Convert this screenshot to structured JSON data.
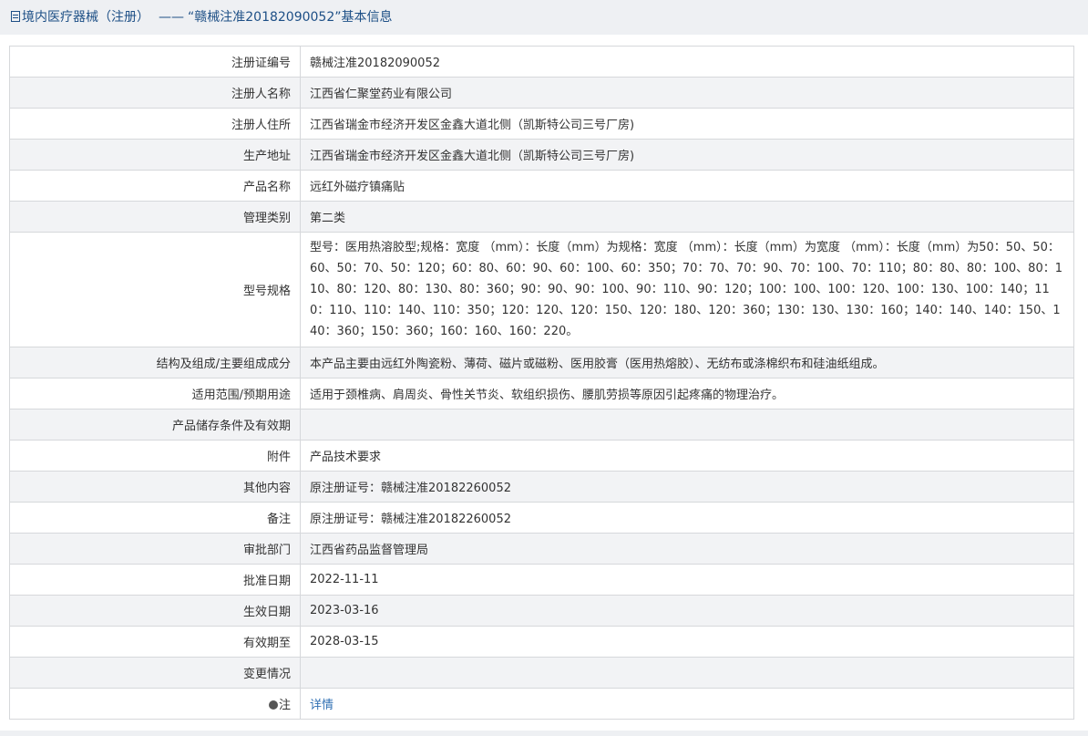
{
  "header": {
    "category": "境内医疗器械（注册）",
    "separator": "——",
    "title": "“赣械注准20182090052”基本信息"
  },
  "rows": [
    {
      "label": "注册证编号",
      "value": "赣械注准20182090052"
    },
    {
      "label": "注册人名称",
      "value": "江西省仁聚堂药业有限公司"
    },
    {
      "label": "注册人住所",
      "value": "江西省瑞金市经济开发区金鑫大道北侧（凯斯特公司三号厂房)"
    },
    {
      "label": "生产地址",
      "value": "江西省瑞金市经济开发区金鑫大道北侧（凯斯特公司三号厂房)"
    },
    {
      "label": "产品名称",
      "value": "远红外磁疗镇痛贴"
    },
    {
      "label": "管理类别",
      "value": "第二类"
    },
    {
      "label": "型号规格",
      "value": "型号：医用热溶胶型;规格：宽度 （mm）：长度（mm）为规格：宽度 （mm）：长度（mm）为宽度 （mm）：长度（mm）为50：50、50：60、50：70、50：120；60：80、60：90、60：100、60：350；70：70、70：90、70：100、70：110；80：80、80：100、80：110、80：120、80：130、80：360；90：90、90：100、90：110、90：120；100：100、100：120、100：130、100：140；110：110、110：140、110：350；120：120、120：150、120：180、120：360；130：130、130：160；140：140、140：150、140：360；150：360；160：160、160：220。"
    },
    {
      "label": "结构及组成/主要组成成分",
      "value": "本产品主要由远红外陶瓷粉、薄荷、磁片或磁粉、医用胶膏（医用热熔胶）、无纺布或涤棉织布和硅油纸组成。"
    },
    {
      "label": "适用范围/预期用途",
      "value": "适用于颈椎病、肩周炎、骨性关节炎、软组织损伤、腰肌劳损等原因引起疼痛的物理治疗。"
    },
    {
      "label": "产品储存条件及有效期",
      "value": ""
    },
    {
      "label": "附件",
      "value": "产品技术要求"
    },
    {
      "label": "其他内容",
      "value": "原注册证号：赣械注准20182260052"
    },
    {
      "label": "备注",
      "value": "原注册证号：赣械注准20182260052"
    },
    {
      "label": "审批部门",
      "value": "江西省药品监督管理局"
    },
    {
      "label": "批准日期",
      "value": "2022-11-11"
    },
    {
      "label": "生效日期",
      "value": "2023-03-16"
    },
    {
      "label": "有效期至",
      "value": "2028-03-15"
    },
    {
      "label": "变更情况",
      "value": ""
    }
  ],
  "note": {
    "label": "注",
    "link_text": "详情"
  }
}
